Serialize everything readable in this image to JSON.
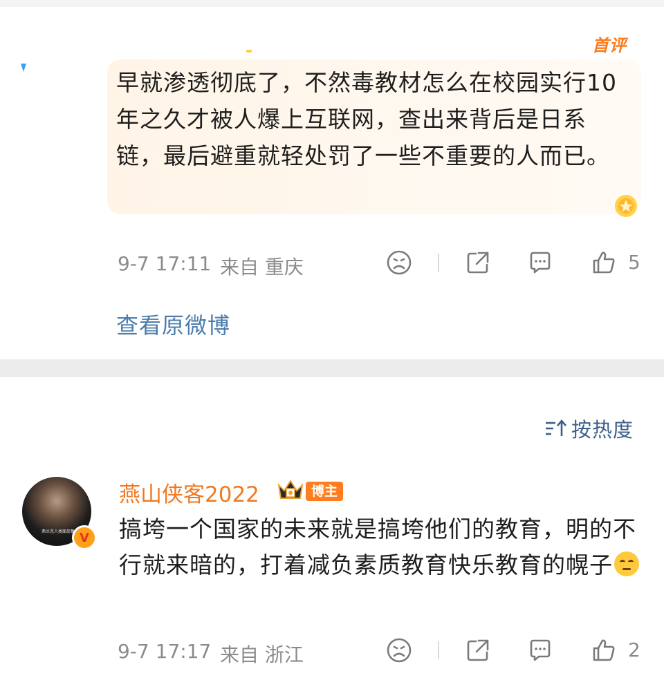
{
  "first_comment": {
    "badge": "首评",
    "text": "早就渗透彻底了，不然毒教材怎么在校园实行10年之久才被人爆上互联网，查出来背后是日系链，最后避重就轻处罚了一些不重要的人而已。",
    "time": "9-7 17:11",
    "from": "来自 重庆",
    "likes": "5",
    "view_original": "查看原微博"
  },
  "sort": {
    "label": "按热度",
    "icon": "sort-icon"
  },
  "second_comment": {
    "user_name": "燕山侠客2022",
    "tag": "博主",
    "verified_badge": "V",
    "avatar_caption": "弗兰克人类面部集",
    "text": "搞垮一个国家的未来就是搞垮他们的教育，明的不行就来暗的，打着减负素质教育快乐教育的幌子",
    "time": "9-7 17:17",
    "from": "来自 浙江",
    "likes": "2"
  },
  "icons": {
    "dislike": "sad-face-icon",
    "share": "share-icon",
    "reply": "comment-icon",
    "like": "thumbs-up-icon"
  },
  "colors": {
    "username": "#f07a22",
    "link": "#4c7daa",
    "meta": "#8b8b8b",
    "accent": "#ff7d1f"
  }
}
